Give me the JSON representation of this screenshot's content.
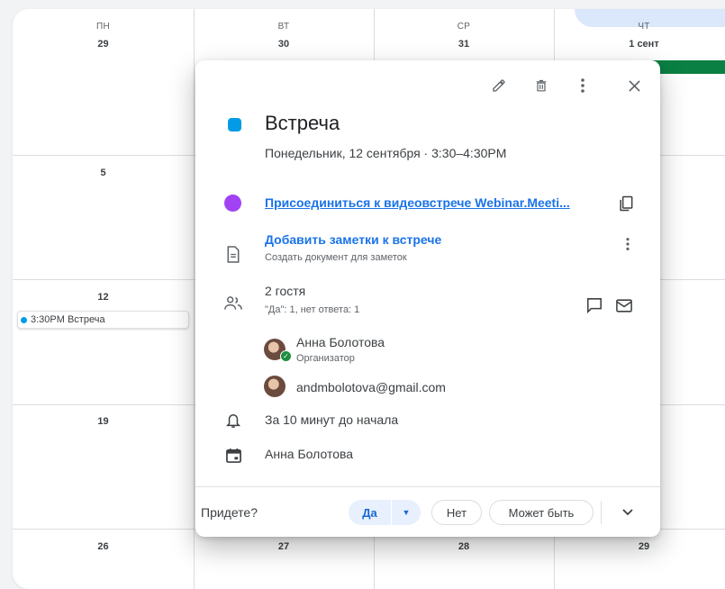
{
  "calendar": {
    "days": [
      {
        "name": "ПН",
        "date": "29"
      },
      {
        "name": "ВТ",
        "date": "30"
      },
      {
        "name": "СР",
        "date": "31"
      },
      {
        "name": "ЧТ",
        "date": "1 сент"
      }
    ],
    "week_dates": [
      "5",
      "12",
      "19",
      "26"
    ],
    "bottom_dates": [
      "27",
      "28",
      "29"
    ],
    "event_chip": "3:30PM Встреча"
  },
  "popup": {
    "title": "Встреча",
    "datetime": "Понедельник, 12 сентября  ·  3:30–4:30PM",
    "video_link": "Присоединиться к видеовстрече Webinar.Meeti...",
    "notes_title": "Добавить заметки к встрече",
    "notes_sub": "Создать документ для заметок",
    "guests_count": "2 гостя",
    "guests_status": "\"Да\": 1, нет ответа: 1",
    "guests": [
      {
        "name": "Анна Болотова",
        "role": "Организатор"
      },
      {
        "name": "andmbolotova@gmail.com"
      }
    ],
    "reminder": "За 10 минут до начала",
    "calendar_owner": "Анна Болотова",
    "rsvp": {
      "question": "Придете?",
      "yes": "Да",
      "no": "Нет",
      "maybe": "Может быть"
    }
  },
  "colors": {
    "event": "#039be5",
    "video": "#a142f4",
    "accent": "#1a73e8",
    "green": "#0b8043"
  }
}
